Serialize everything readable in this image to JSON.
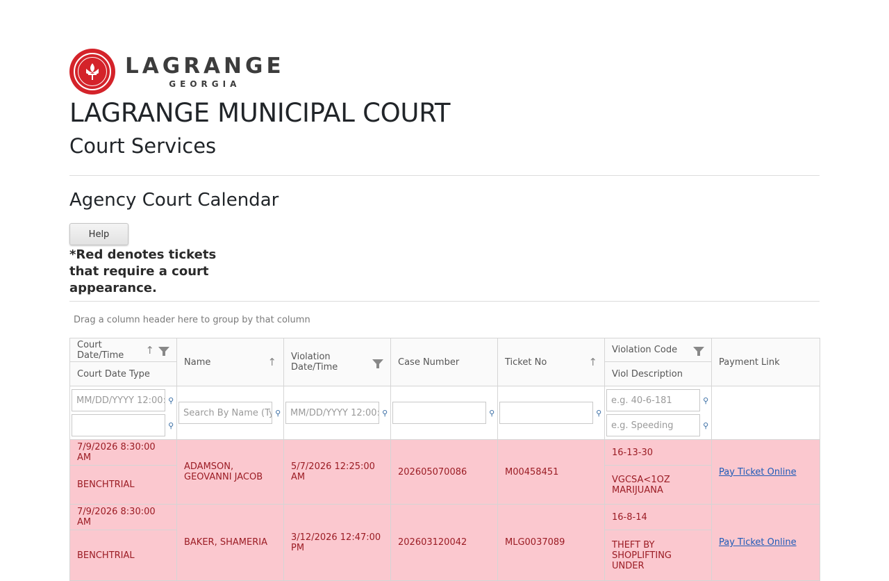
{
  "logo": {
    "main": "LAGRANGE",
    "sub": "GEORGIA"
  },
  "title": "LAGRANGE MUNICIPAL COURT",
  "subtitle": "Court Services",
  "section_title": "Agency Court Calendar",
  "help_label": "Help",
  "note": "*Red denotes tickets that require a court appearance.",
  "group_hint": "Drag a column header here to group by that column",
  "columns": {
    "court_date": "Court Date/Time",
    "court_date_type": "Court Date Type",
    "name": "Name",
    "violation_date": "Violation Date/Time",
    "case_number": "Case Number",
    "ticket_no": "Ticket No",
    "violation_code": "Violation Code",
    "viol_description": "Viol Description",
    "payment_link": "Payment Link"
  },
  "filters": {
    "court_date_placeholder": "MM/DD/YYYY 12:00:",
    "name_placeholder": "Search By Name (Typ",
    "violation_date_placeholder": "MM/DD/YYYY 12:00:",
    "violation_code_placeholder": "e.g. 40-6-181",
    "viol_description_placeholder": "e.g. Speeding"
  },
  "rows": [
    {
      "court_date": "7/9/2026 8:30:00 AM",
      "court_date_type": "BENCHTRIAL",
      "name": "ADAMSON, GEOVANNI JACOB",
      "violation_date": "5/7/2026 12:25:00 AM",
      "case_number": "202605070086",
      "ticket_no": "M00458451",
      "violation_code": "16-13-30",
      "viol_description": "VGCSA<1OZ MARIJUANA",
      "payment_link": "Pay Ticket Online"
    },
    {
      "court_date": "7/9/2026 8:30:00 AM",
      "court_date_type": "BENCHTRIAL",
      "name": "BAKER, SHAMERIA",
      "violation_date": "3/12/2026 12:47:00 PM",
      "case_number": "202603120042",
      "ticket_no": "MLG0037089",
      "violation_code": "16-8-14",
      "viol_description": "THEFT BY SHOPLIFTING UNDER",
      "payment_link": "Pay Ticket Online"
    }
  ],
  "colors": {
    "red_row": "#fbc8cf",
    "red_text": "#9b1c24",
    "link": "#1e5bb8",
    "seal": "#d4232a"
  }
}
